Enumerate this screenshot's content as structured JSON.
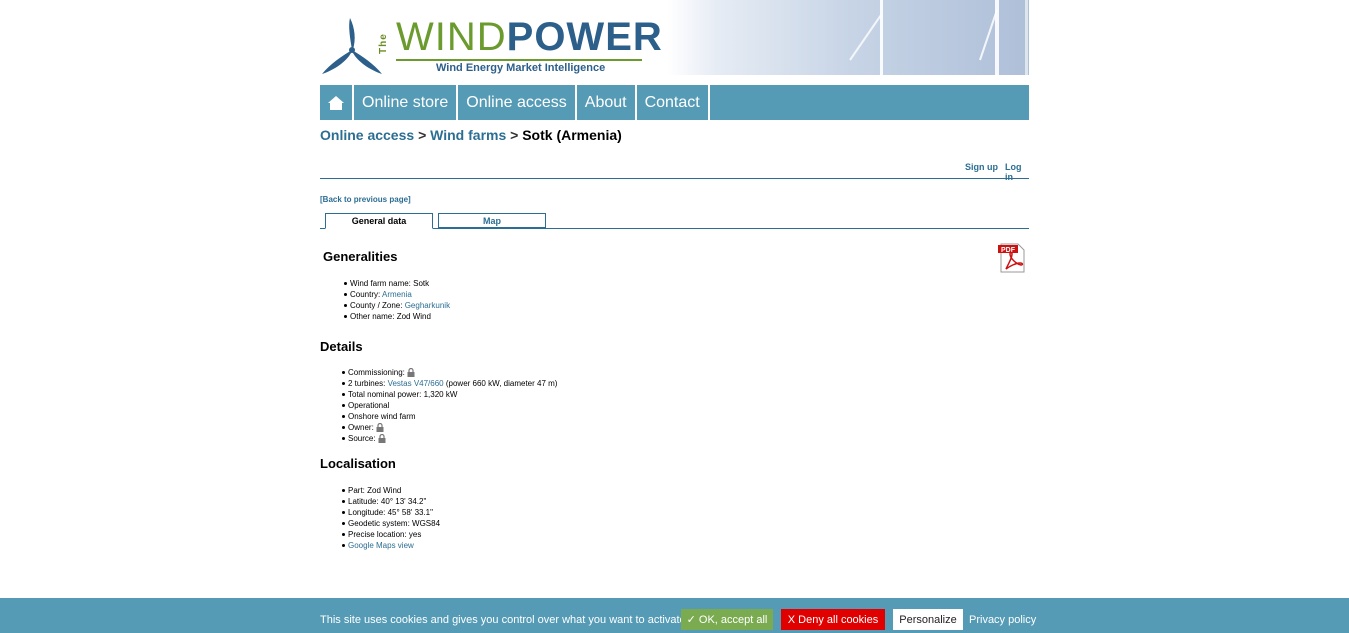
{
  "logo": {
    "the": "The",
    "wind": "WIND",
    "power": "POWER",
    "tagline": "Wind Energy Market Intelligence"
  },
  "nav": {
    "home_icon": "home-icon",
    "items": [
      "Online store",
      "Online access",
      "About",
      "Contact"
    ]
  },
  "breadcrumb": {
    "crumb1": "Online access",
    "sep1": ">",
    "crumb2": "Wind farms",
    "sep2": ">",
    "current": "Sotk (Armenia)"
  },
  "auth": {
    "signup": "Sign up",
    "login": "Log in"
  },
  "back_link": "[Back to previous page]",
  "tabs": {
    "general": "General data",
    "map": "Map"
  },
  "pdf_icon": "pdf-icon",
  "generalities": {
    "title": "Generalities",
    "name_label": "Wind farm name: ",
    "name_value": "Sotk",
    "country_label": "Country: ",
    "country_value": "Armenia",
    "zone_label": "County / Zone: ",
    "zone_value": "Gegharkunik",
    "other_label": "Other name: ",
    "other_value": "Zod Wind"
  },
  "details": {
    "title": "Details",
    "commissioning_label": "Commissioning: ",
    "turbines_label": "2 turbines: ",
    "turbines_link": "Vestas V47/660",
    "turbines_info": " (power 660 kW, diameter 47 m)",
    "total_label": "Total nominal power: ",
    "total_value": "1,320 kW",
    "status": "Operational",
    "type": "Onshore wind farm",
    "owner_label": "Owner: ",
    "source_label": "Source: "
  },
  "localisation": {
    "title": "Localisation",
    "part_label": "Part: ",
    "part_value": "Zod Wind",
    "lat_label": "Latitude: ",
    "lat_value": "40° 13' 34.2\"",
    "lon_label": "Longitude: ",
    "lon_value": "45° 58' 33.1\"",
    "geo_label": "Geodetic system: ",
    "geo_value": "WGS84",
    "precise_label": "Precise location: ",
    "precise_value": "yes",
    "maps_link": "Google Maps view"
  },
  "cookie": {
    "text": "This site uses cookies and gives you control over what you want to activate",
    "accept": "✓ OK, accept all",
    "deny": "X Deny all cookies",
    "personalize": "Personalize",
    "privacy": "Privacy policy"
  },
  "colors": {
    "nav": "#559bb6",
    "link": "#2c6e93",
    "accept": "#7bab50",
    "deny": "#e00000"
  }
}
